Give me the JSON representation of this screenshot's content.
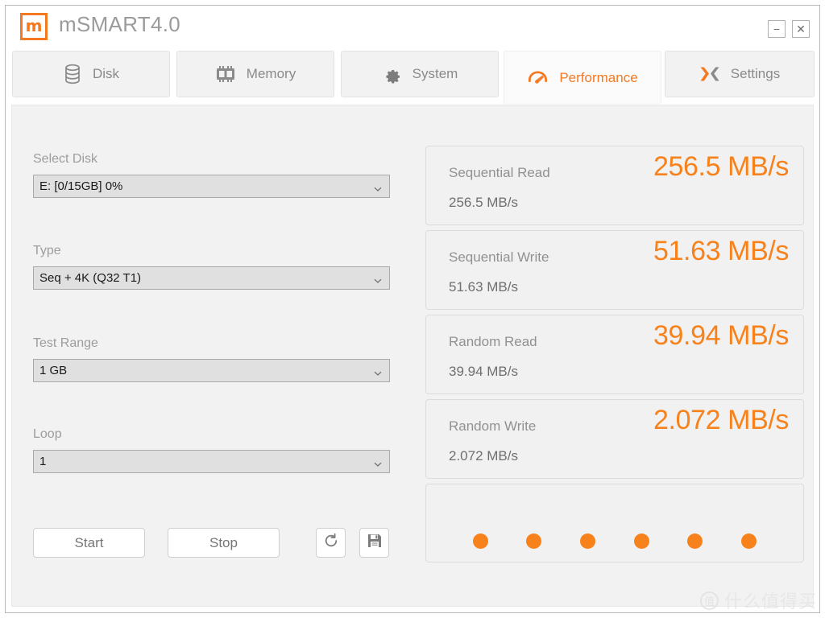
{
  "window": {
    "logo_glyph": "m",
    "title": "mSMART4.0",
    "minimize_label": "−",
    "close_label": "✕"
  },
  "tabs": [
    {
      "id": "disk",
      "label": "Disk",
      "icon": "disk-icon",
      "active": false
    },
    {
      "id": "memory",
      "label": "Memory",
      "icon": "memory-icon",
      "active": false
    },
    {
      "id": "system",
      "label": "System",
      "icon": "gear-icon",
      "active": false
    },
    {
      "id": "performance",
      "label": "Performance",
      "icon": "speedometer-icon",
      "active": true
    },
    {
      "id": "settings",
      "label": "Settings",
      "icon": "x-arrows-icon",
      "active": false
    }
  ],
  "controls": {
    "select_disk": {
      "label": "Select Disk",
      "value": "E: [0/15GB] 0%"
    },
    "type": {
      "label": "Type",
      "value": "Seq + 4K (Q32 T1)"
    },
    "test_range": {
      "label": "Test Range",
      "value": "1 GB"
    },
    "loop": {
      "label": "Loop",
      "value": "1"
    },
    "start_label": "Start",
    "stop_label": "Stop",
    "refresh_icon": "refresh-icon",
    "save_icon": "save-icon"
  },
  "results": [
    {
      "name": "Sequential Read",
      "value": "256.5 MB/s",
      "detail": "256.5 MB/s"
    },
    {
      "name": "Sequential Write",
      "value": "51.63 MB/s",
      "detail": "51.63 MB/s"
    },
    {
      "name": "Random Read",
      "value": "39.94 MB/s",
      "detail": "39.94 MB/s"
    },
    {
      "name": "Random Write",
      "value": "2.072 MB/s",
      "detail": "2.072 MB/s"
    }
  ],
  "progress": {
    "dot_count": 6
  },
  "watermark": {
    "badge": "值",
    "text": "什么值得买"
  },
  "colors": {
    "accent": "#f47920",
    "value_orange": "#f7821b",
    "label_gray": "#9d9d9d",
    "body_bg": "#f2f2f2"
  }
}
